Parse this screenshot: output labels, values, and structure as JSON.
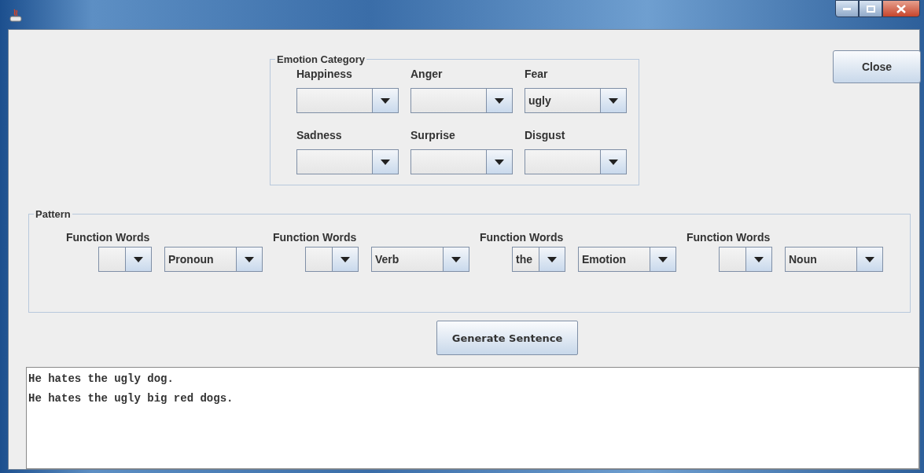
{
  "emotion_category": {
    "title": "Emotion Category",
    "combos": [
      {
        "label": "Happiness"
      },
      {
        "label": "Anger"
      },
      {
        "label": "Fear",
        "value": "ugly"
      },
      {
        "label": "Sadness"
      },
      {
        "label": "Surprise"
      },
      {
        "label": "Disgust"
      }
    ]
  },
  "close_button": "Close",
  "pattern": {
    "title": "Pattern",
    "slots": [
      {
        "label": "Function Words",
        "word_class": "Pronoun"
      },
      {
        "label": "Function Words",
        "word_class": "Verb"
      },
      {
        "label": "Function Words",
        "function_word": "the",
        "word_class": "Emotion"
      },
      {
        "label": "Function Words",
        "word_class": "Noun"
      }
    ]
  },
  "generate_button": "Generate Sentence",
  "output": {
    "lines": [
      "He hates the ugly dog.",
      "He hates the ugly big red dogs."
    ]
  }
}
